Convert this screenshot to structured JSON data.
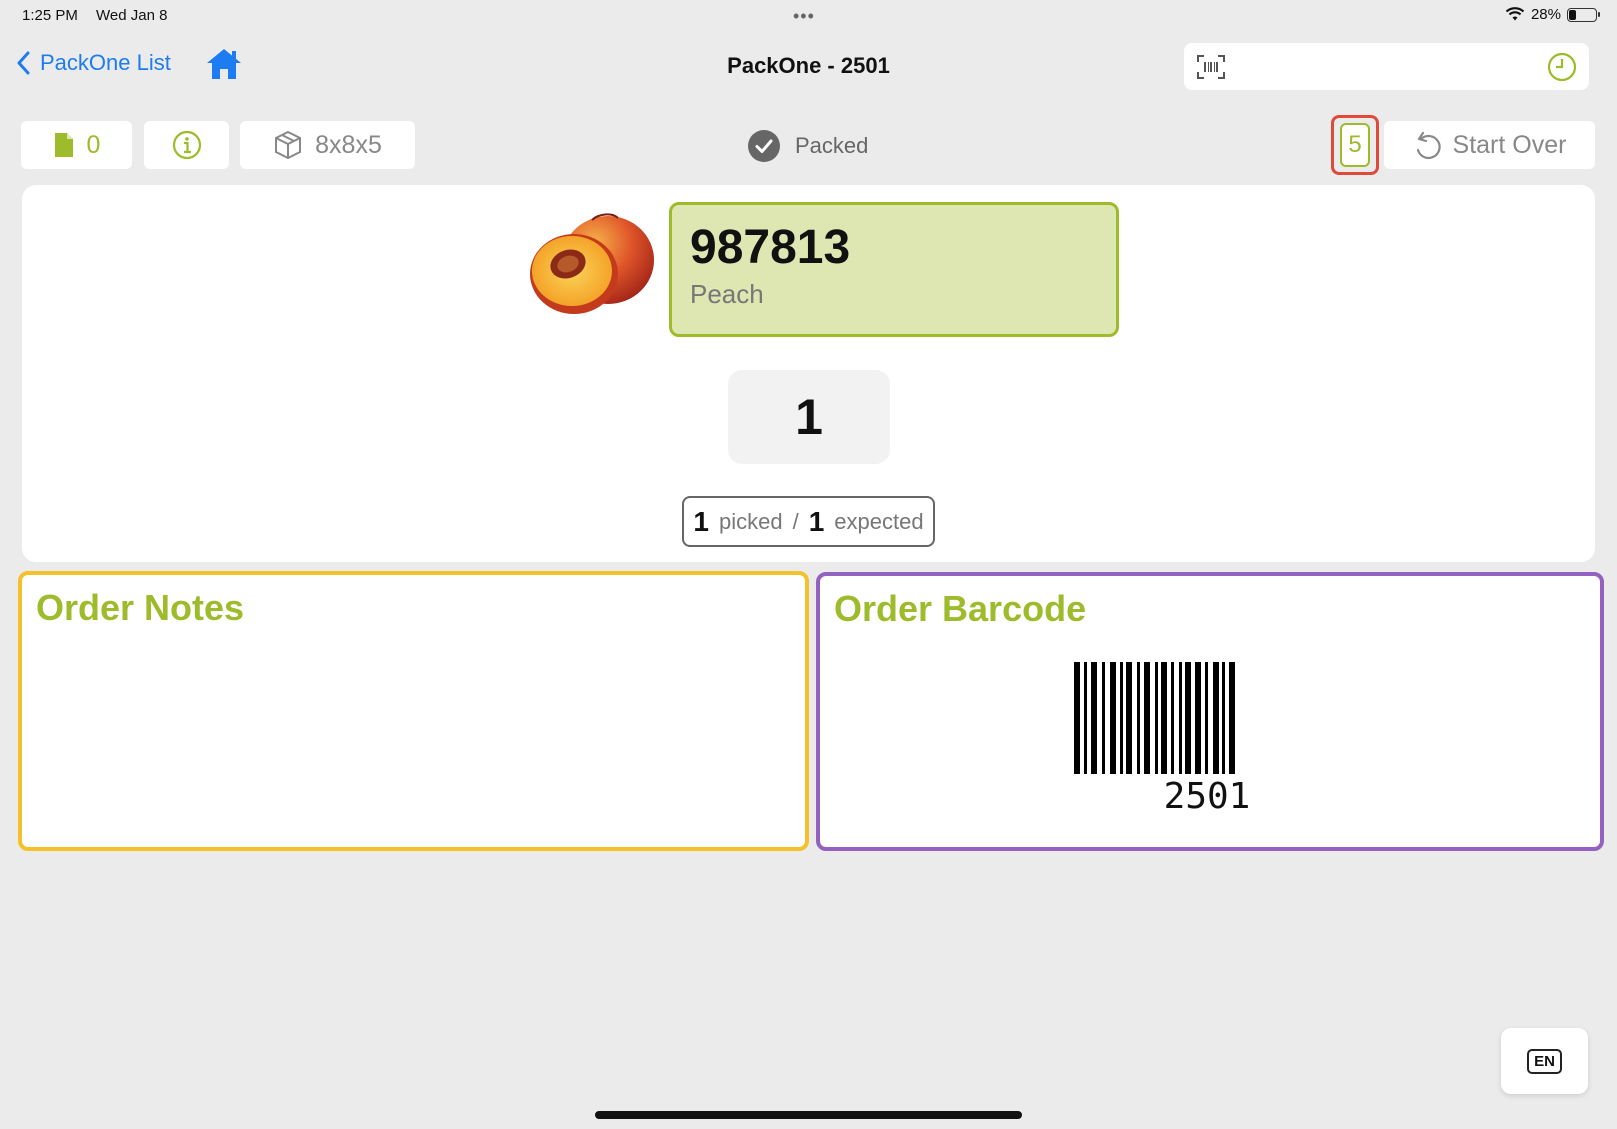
{
  "status_bar": {
    "time": "1:25 PM",
    "date": "Wed Jan 8",
    "battery": "28%",
    "battery_level": 0.28
  },
  "nav": {
    "back_label": "PackOne List",
    "title": "PackOne - 2501"
  },
  "scan": {
    "value": "",
    "placeholder": ""
  },
  "toolbar": {
    "docs_count": "0",
    "box_size": "8x8x5",
    "status_label": "Packed",
    "item_count": "5",
    "start_over_label": "Start Over"
  },
  "item": {
    "sku": "987813",
    "name": "Peach",
    "quantity": "1",
    "picked": "1",
    "picked_label": "picked",
    "separator": "/",
    "expected": "1",
    "expected_label": "expected"
  },
  "notes": {
    "title": "Order Notes",
    "text": ""
  },
  "barcode": {
    "title": "Order Barcode",
    "value": "2501"
  },
  "language": {
    "label": "EN"
  },
  "colors": {
    "accent_green": "#9dbb2a",
    "link_blue": "#1e7cf2",
    "notes_border": "#f4c12a",
    "barcode_border": "#9461c0",
    "highlight_red": "#e04a3b"
  },
  "icons": {
    "back": "chevron-left-icon",
    "home": "home-icon",
    "scan": "barcode-scan-icon",
    "history": "clock-icon",
    "docs": "document-icon",
    "info": "info-icon",
    "box": "box-icon",
    "status": "checkmark-circle-icon",
    "start_over": "rotate-left-icon",
    "language": "keyboard-language-icon"
  }
}
